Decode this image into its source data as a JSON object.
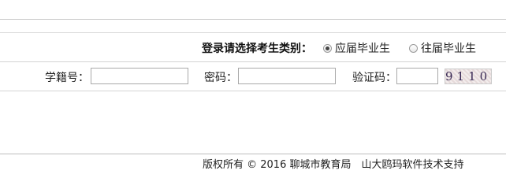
{
  "login_type": {
    "prompt": "登录请选择考生类别：",
    "options": [
      {
        "label": "应届毕业生",
        "selected": true
      },
      {
        "label": "往届毕业生",
        "selected": false
      }
    ]
  },
  "form": {
    "student_id_label": "学籍号：",
    "student_id_value": "",
    "password_label": "密码：",
    "password_value": "",
    "captcha_label": "验证码：",
    "captcha_value": "",
    "captcha_image_text": "9110"
  },
  "footer": {
    "text": "版权所有 © 2016 聊城市教育局　山大鸥玛软件技术支持"
  }
}
